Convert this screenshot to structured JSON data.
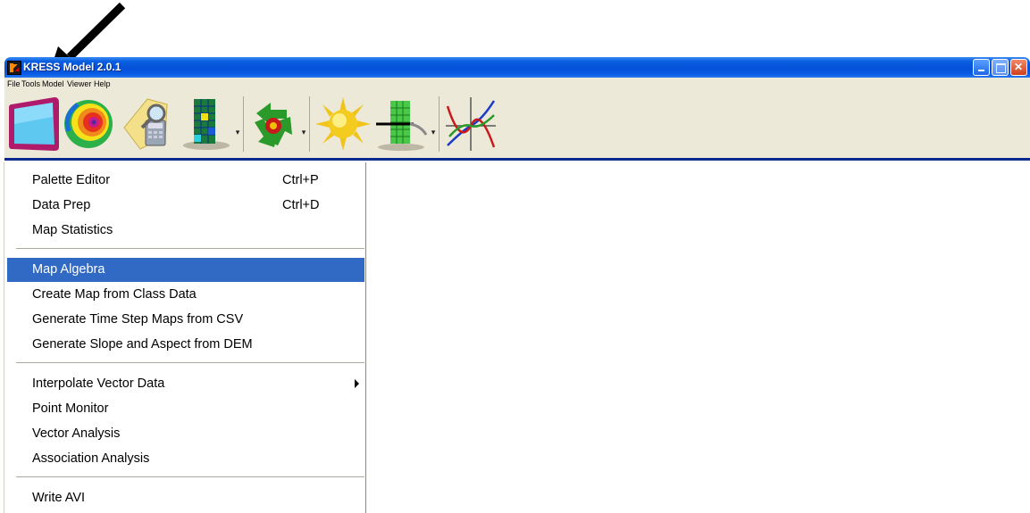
{
  "window": {
    "title": "KRESS Model 2.0.1"
  },
  "menubar": [
    "File",
    "Tools",
    "Model",
    "Viewer",
    "Help"
  ],
  "toolbar": {
    "buttons": [
      {
        "icon": "window-frame-icon"
      },
      {
        "icon": "spiral-palette-icon"
      },
      {
        "icon": "data-prep-magnifier-icon"
      },
      {
        "icon": "grid-map-icon"
      },
      {
        "icon": "recycle-arrows-icon"
      },
      {
        "icon": "sun-icon"
      },
      {
        "icon": "vector-grid-icon"
      },
      {
        "icon": "curves-graph-icon"
      }
    ]
  },
  "tools_menu": {
    "items": [
      {
        "label": "Palette Editor",
        "shortcut": "Ctrl+P"
      },
      {
        "label": "Data Prep",
        "shortcut": "Ctrl+D"
      },
      {
        "label": "Map Statistics",
        "shortcut": ""
      },
      {
        "label": "Map Algebra",
        "shortcut": "",
        "highlighted": true
      },
      {
        "label": "Create Map from Class Data",
        "shortcut": ""
      },
      {
        "label": "Generate Time Step Maps from CSV",
        "shortcut": ""
      },
      {
        "label": "Generate Slope and Aspect from DEM",
        "shortcut": ""
      },
      {
        "label": "Interpolate Vector Data",
        "shortcut": "",
        "submenu": true
      },
      {
        "label": "Point Monitor",
        "shortcut": ""
      },
      {
        "label": "Vector Analysis",
        "shortcut": ""
      },
      {
        "label": "Association Analysis",
        "shortcut": ""
      },
      {
        "label": "Write AVI",
        "shortcut": ""
      }
    ]
  },
  "colors": {
    "titlebar": "#0550d8",
    "menu_highlight": "#316ac5",
    "toolbar_bg": "#ece9d8"
  }
}
